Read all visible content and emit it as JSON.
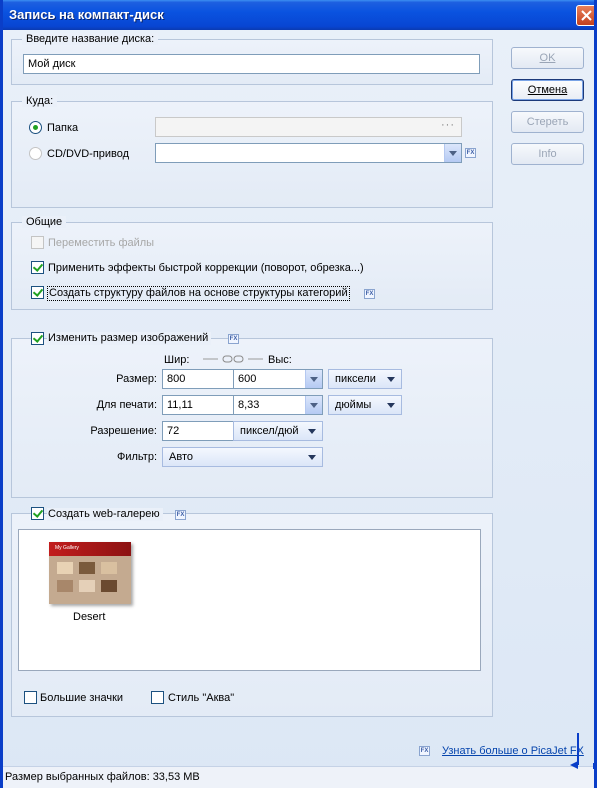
{
  "window": {
    "title": "Запись на компакт-диск",
    "accent": "#0a53e0"
  },
  "disc_name": {
    "legend": "Введите название диска:",
    "value": "Мой диск"
  },
  "buttons": {
    "ok": "OK",
    "cancel": "Отмена",
    "erase": "Стереть",
    "info": "Info"
  },
  "destination": {
    "legend": "Куда:",
    "folder_label": "Папка",
    "folder_value": "",
    "folder_browse": "···",
    "cd_label": "CD/DVD-привод",
    "cd_value": ""
  },
  "general": {
    "legend": "Общие",
    "move_files": "Переместить файлы",
    "apply_effects": "Применить эффекты быстрой коррекции (поворот, обрезка...)",
    "create_structure": "Создать структуру файлов на основе структуры категорий"
  },
  "resize": {
    "checkbox_label": "Изменить размер изображений",
    "width_header": "Шир:",
    "height_header": "Выс:",
    "size_label": "Размер:",
    "size_width": "800",
    "size_height": "600",
    "size_unit": "пиксели",
    "print_label": "Для печати:",
    "print_width": "11,11",
    "print_height": "8,33",
    "print_unit": "дюймы",
    "resolution_label": "Разрешение:",
    "resolution_value": "72",
    "resolution_unit": "пиксел/дюй",
    "filter_label": "Фильтр:",
    "filter_value": "Авто"
  },
  "web_gallery": {
    "checkbox_label": "Создать web-галерею",
    "items": [
      {
        "name": "Desert",
        "thumb_header": "My Gallery"
      }
    ],
    "large_icons": "Большие значки",
    "aqua_style": "Стиль \"Аква\""
  },
  "footer": {
    "learn_more": "Узнать больше о PicaJet FX",
    "status": "Размер выбранных файлов: 33,53 MB"
  },
  "icons": {
    "fx": "fx-icon",
    "close": "close-icon",
    "link": "link-icon"
  }
}
